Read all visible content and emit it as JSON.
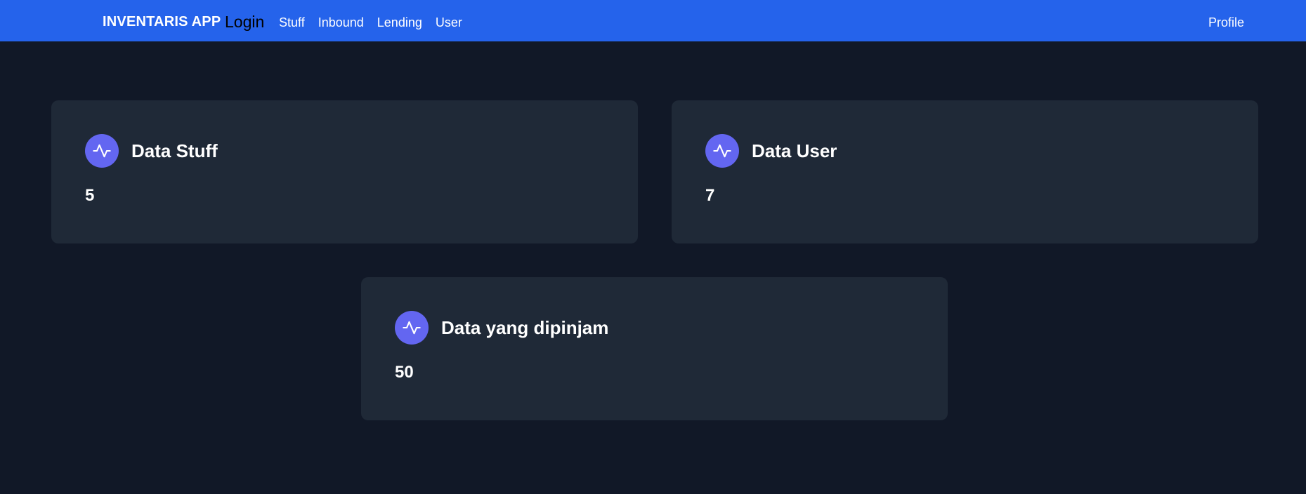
{
  "navbar": {
    "brand": "INVENTARIS APP",
    "login_label": "Login",
    "links": [
      "Stuff",
      "Inbound",
      "Lending",
      "User"
    ],
    "profile_label": "Profile"
  },
  "cards": [
    {
      "title": "Data Stuff",
      "value": "5",
      "icon": "activity-icon"
    },
    {
      "title": "Data User",
      "value": "7",
      "icon": "activity-icon"
    },
    {
      "title": "Data yang dipinjam",
      "value": "50",
      "icon": "activity-icon"
    }
  ],
  "colors": {
    "navbar_bg": "#2563eb",
    "page_bg": "#111827",
    "card_bg": "#1f2937",
    "icon_bg": "#6366f1"
  }
}
